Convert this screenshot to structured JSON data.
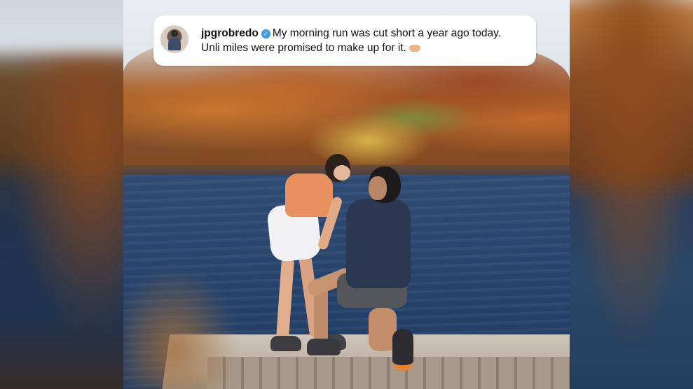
{
  "post": {
    "username": "jpgrobredo",
    "verified": true,
    "caption_line1": "My morning run was cut short a year ago today.",
    "caption_line2": "Unli miles were promised to make up for it.",
    "emoji_icon": "handshake-icon"
  },
  "colors": {
    "verified_badge": "#3b9ae8",
    "caption_bg": "#ffffff",
    "text": "#111111"
  }
}
